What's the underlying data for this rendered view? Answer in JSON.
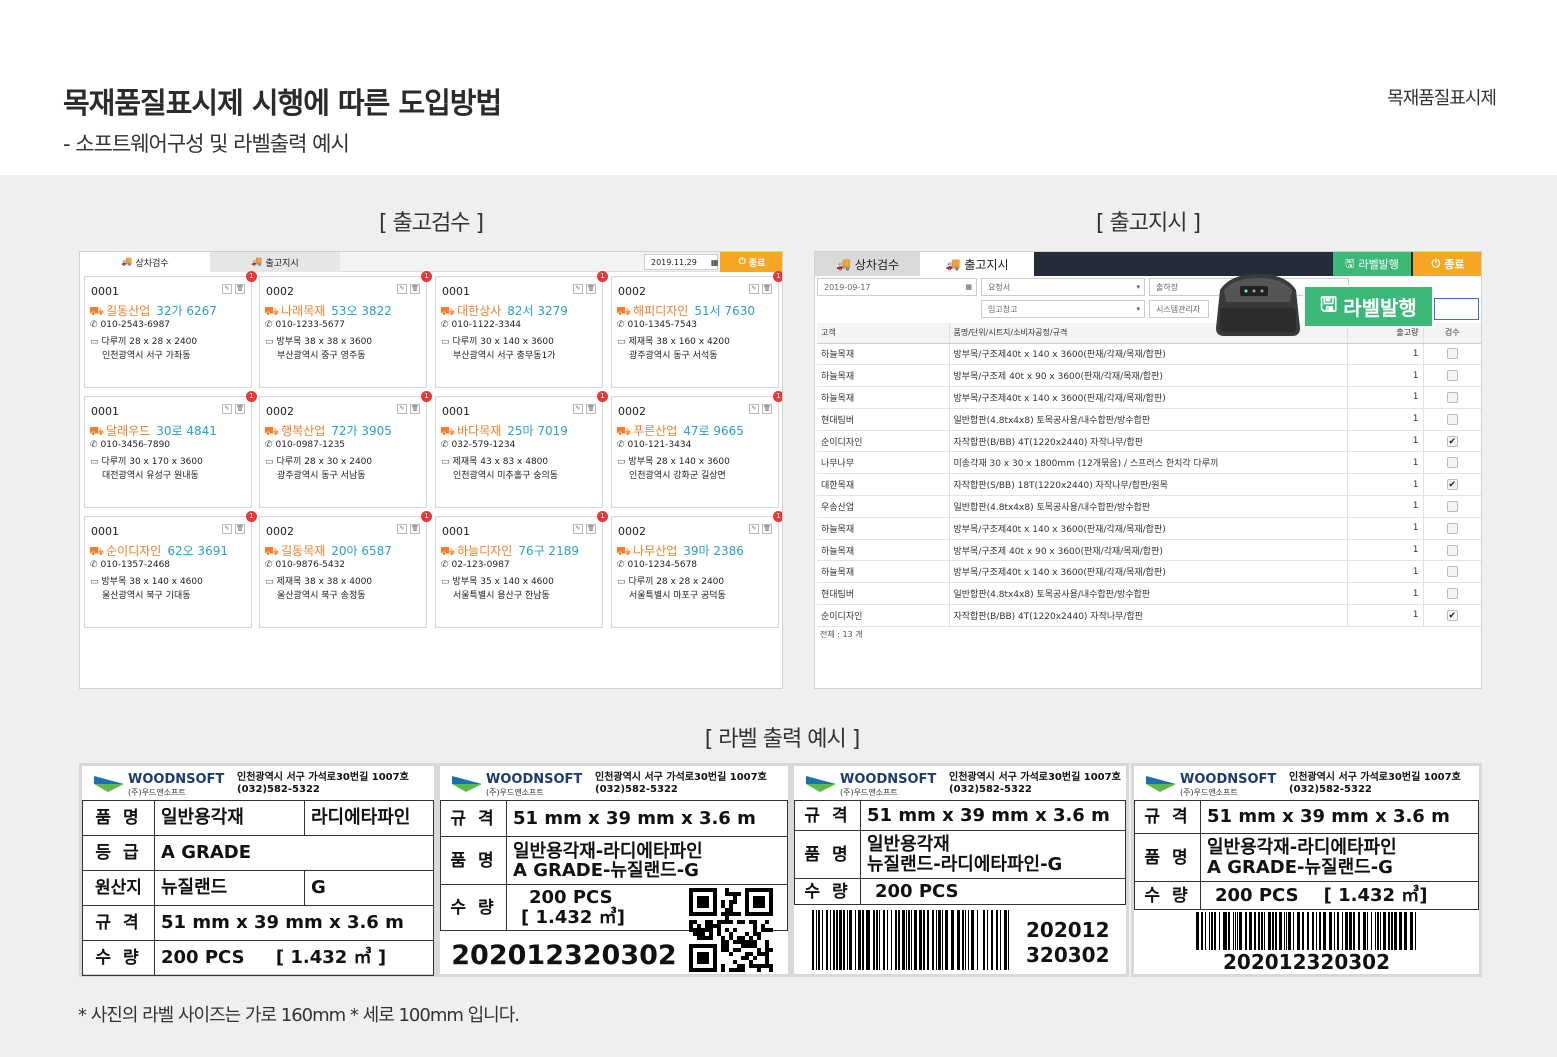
{
  "header": {
    "title": "목재품질표시제 시행에  따른 도입방법",
    "subtitle": "- 소프트웨어구성 및 라벨출력 예시",
    "brand": "목재품질표시제"
  },
  "sections": {
    "inspect": "[ 출고검수 ]",
    "order": "[ 출고지시 ]",
    "labels": "[ 라벨 출력 예시 ]"
  },
  "panel1": {
    "tab_inspect": "상차검수",
    "tab_order": "출고지시",
    "date": "2019.11.29",
    "exit": "종료",
    "cards": [
      {
        "code": "0001",
        "company": "길동산업",
        "plate": "32가 6267",
        "phone": "010-2543-6987",
        "item": "다루끼  28 x 28 x 2400",
        "addr": "인천광역시 서구 가좌동",
        "badge": "1"
      },
      {
        "code": "0002",
        "company": "나래목재",
        "plate": "53오 3822",
        "phone": "010-1233-5677",
        "item": "방부목  38 x 38 x 3600",
        "addr": "부산광역시 중구 영주동",
        "badge": "1"
      },
      {
        "code": "0001",
        "company": "대한상사",
        "plate": "82서 3279",
        "phone": "010-1122-3344",
        "item": "다루끼  30 x 140 x 3600",
        "addr": "부산광역시 서구 충무동1가",
        "badge": "1"
      },
      {
        "code": "0002",
        "company": "해피디자인",
        "plate": "51서 7630",
        "phone": "010-1345-7543",
        "item": "제재목  38 x 160 x 4200",
        "addr": "광주광역시 동구 서석동",
        "badge": "1"
      },
      {
        "code": "0001",
        "company": "달래우드",
        "plate": "30로 4841",
        "phone": "010-3456-7890",
        "item": "다루끼  30 x 170 x 3600",
        "addr": "대전광역시 유성구 원내동",
        "badge": "1"
      },
      {
        "code": "0002",
        "company": "행복산업",
        "plate": "72가 3905",
        "phone": "010-0987-1235",
        "item": "다루끼  28 x 30 x 2400",
        "addr": "광주광역시 동구 서남동",
        "badge": "1"
      },
      {
        "code": "0001",
        "company": "바다목재",
        "plate": "25마 7019",
        "phone": "032-579-1234",
        "item": "제재목  43 x 83 x 4800",
        "addr": "인천광역시 미추홀구 숭의동",
        "badge": "1"
      },
      {
        "code": "0002",
        "company": "푸른산업",
        "plate": "47로 9665",
        "phone": "010-121-3434",
        "item": "방부목  28 x 140 x 3600",
        "addr": "인천광역시 강화군 길상면",
        "badge": "1"
      },
      {
        "code": "0001",
        "company": "순이디자인",
        "plate": "62오 3691",
        "phone": "010-1357-2468",
        "item": "방부목  38 x 140 x 4600",
        "addr": "울산광역시 북구 기대동",
        "badge": "1"
      },
      {
        "code": "0002",
        "company": "길동목재",
        "plate": "20아 6587",
        "phone": "010-9876-5432",
        "item": "제재목  38 x 38 x 4000",
        "addr": "울산광역시 북구 송정동",
        "badge": "1"
      },
      {
        "code": "0001",
        "company": "하늘디자인",
        "plate": "76구 2189",
        "phone": "02-123-0987",
        "item": "방부목  35 x 140 x 4600",
        "addr": "서울특별시 용산구 한남동",
        "badge": "1"
      },
      {
        "code": "0002",
        "company": "나무산업",
        "plate": "39마 2386",
        "phone": "010-1234-5678",
        "item": "다루끼  28 x 28 x 2400",
        "addr": "서울특별시 마포구 공덕동",
        "badge": "1"
      }
    ]
  },
  "panel2": {
    "tab_inspect": "상차검수",
    "tab_order": "출고지시",
    "label_btn": "라벨발행",
    "exit": "종료",
    "date": "2019-09-17",
    "f_req": "요청서",
    "f_ship": "출하장",
    "f_wh": "입고창고",
    "f_sys": "시스템관리자",
    "headers": {
      "customer": "고객",
      "item": "품명/단위/시트지/소비자공정/규격",
      "qty": "출고량",
      "check": "검수"
    },
    "rows": [
      {
        "c": "하늘목재",
        "i": "방부목/구조제40t x 140 x 3600(판재/각재/목재/합판)",
        "q": "1",
        "k": ""
      },
      {
        "c": "하늘목재",
        "i": "방부목/구조제 40t x 90 x 3600(판재/각재/목재/합판)",
        "q": "1",
        "k": ""
      },
      {
        "c": "하늘목재",
        "i": "방부목/구조제40t x 140 x 3600(판재/각재/목재/합판)",
        "q": "1",
        "k": ""
      },
      {
        "c": "현대팀버",
        "i": "일반합판(4.8tx4x8) 토목공사용/내수합판/방수합판",
        "q": "1",
        "k": ""
      },
      {
        "c": "순이디자인",
        "i": "자작합판(B/BB) 4T(1220x2440) 자작나무/합판",
        "q": "1",
        "k": "✔"
      },
      {
        "c": "나무나무",
        "i": "미송각재 30 x 30 x 1800mm (12개묶음) / 스프러스 한치각 다루끼",
        "q": "1",
        "k": ""
      },
      {
        "c": "대한목재",
        "i": "자작합판(S/BB) 18T(1220x2440) 자작나무/합판/원목",
        "q": "1",
        "k": "✔"
      },
      {
        "c": "우송산업",
        "i": "일반합판(4.8tx4x8) 토목공사용/내수합판/방수합판",
        "q": "1",
        "k": ""
      },
      {
        "c": "하늘목재",
        "i": "방부목/구조제40t x 140 x 3600(판재/각재/목재/합판)",
        "q": "1",
        "k": ""
      },
      {
        "c": "하늘목재",
        "i": "방부목/구조제 40t x 90 x 3600(판재/각재/목재/합판)",
        "q": "1",
        "k": ""
      },
      {
        "c": "하늘목재",
        "i": "방부목/구조제40t x 140 x 3600(판재/각재/목재/합판)",
        "q": "1",
        "k": ""
      },
      {
        "c": "현대팀버",
        "i": "일반합판(4.8tx4x8) 토목공사용/내수합판/방수합판",
        "q": "1",
        "k": ""
      },
      {
        "c": "순이디자인",
        "i": "자작합판(B/BB) 4T(1220x2440) 자작나무/합판",
        "q": "1",
        "k": "✔"
      }
    ],
    "total": "전체 : 13 개",
    "overlay_btn": "라벨발행"
  },
  "label_common": {
    "company": "WOODNSOFT",
    "company_kr": "(주)우드앤소프트",
    "addr1": "인천광역시 서구 가석로30번길 1007호",
    "addr2": "(032)582-5322"
  },
  "label1": {
    "k1": "품 명",
    "v1": "일반용각재",
    "v1b": "라디에타파인",
    "k2": "등 급",
    "v2": "A GRADE",
    "k3": "원산지",
    "v3": "뉴질랜드",
    "v3b": "G",
    "k4": "규 격",
    "v4": "51 mm x 39 mm x 3.6 m",
    "k5": "수 량",
    "v5": "200 PCS     [ 1.432 ㎥ ]"
  },
  "label2": {
    "k1": "규 격",
    "v1": "51 mm x 39 mm x 3.6 m",
    "k2": "품 명",
    "v2a": "일반용각재-라디에타파인",
    "v2b": "A GRADE-뉴질랜드-G",
    "k3": "수 량",
    "v3a": "200 PCS",
    "v3b": "[ 1.432 ㎥]",
    "code": "202012320302"
  },
  "label3": {
    "k1": "규 격",
    "v1": "51 mm x 39 mm x 3.6 m",
    "k2": "품 명",
    "v2a": "일반용각재",
    "v2b": "뉴질랜드-라디에타파인-G",
    "k3": "수 량",
    "v3": "200 PCS",
    "code1": "202012",
    "code2": "320302"
  },
  "label4": {
    "k1": "규 격",
    "v1": "51 mm x 39 mm x 3.6 m",
    "k2": "품 명",
    "v2a": "일반용각재-라디에타파인",
    "v2b": "A GRADE-뉴질랜드-G",
    "k3": "수 량",
    "v3": "200 PCS    [ 1.432 ㎥]",
    "code": "202012320302"
  },
  "note": "* 사진의 라벨 사이즈는 가로 160mm * 세로 100mm 입니다.",
  "colors": {
    "orange": "#f5a623",
    "company": "#f07f2a",
    "plate": "#27a3c4",
    "badge": "#e53935",
    "green": "#3cb878",
    "navy": "#262b3a"
  }
}
